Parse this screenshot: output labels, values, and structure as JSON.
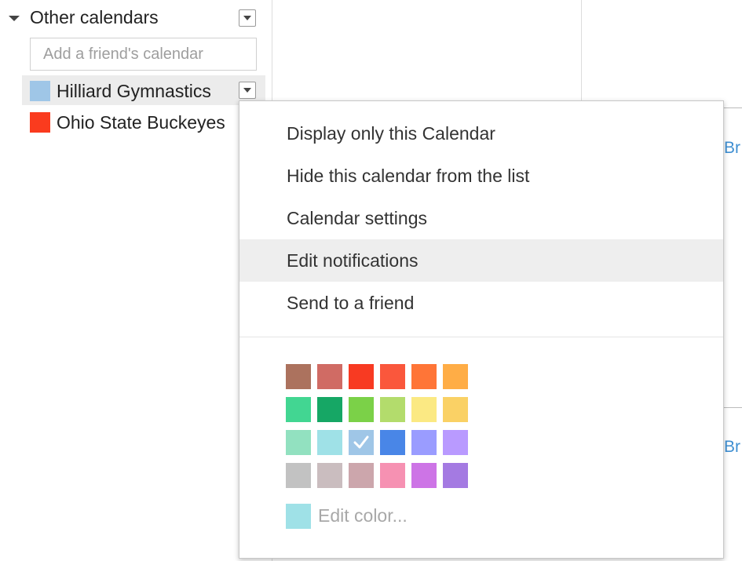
{
  "sidebar": {
    "section_title": "Other calendars",
    "add_placeholder": "Add a friend's calendar",
    "calendars": [
      {
        "label": "Hilliard Gymnastics",
        "color": "#9fc6e7"
      },
      {
        "label": "Ohio State Buckeyes",
        "color": "#fa3b1e"
      }
    ]
  },
  "background": {
    "edge_text_top": "Br",
    "edge_text_bottom": "Br"
  },
  "menu": {
    "items": [
      "Display only this Calendar",
      "Hide this calendar from the list",
      "Calendar settings",
      "Edit notifications",
      "Send to a friend"
    ],
    "hovered_item": "Edit notifications",
    "palette": [
      [
        "#ac725e",
        "#d06b64",
        "#f83a22",
        "#fa573c",
        "#ff7537",
        "#ffad46"
      ],
      [
        "#42d692",
        "#16a765",
        "#7bd148",
        "#b3dc6c",
        "#fbe983",
        "#fad165"
      ],
      [
        "#92e1c0",
        "#9fe1e7",
        "#9fc6e7",
        "#4986e7",
        "#9a9cff",
        "#b99aff"
      ],
      [
        "#c2c2c2",
        "#cabdbf",
        "#cca6ac",
        "#f691b2",
        "#cd74e6",
        "#a47ae2"
      ]
    ],
    "selected_color": "#9fc6e7",
    "edit_color_label": "Edit color...",
    "edit_color_swatch": "#9fe1e7"
  }
}
